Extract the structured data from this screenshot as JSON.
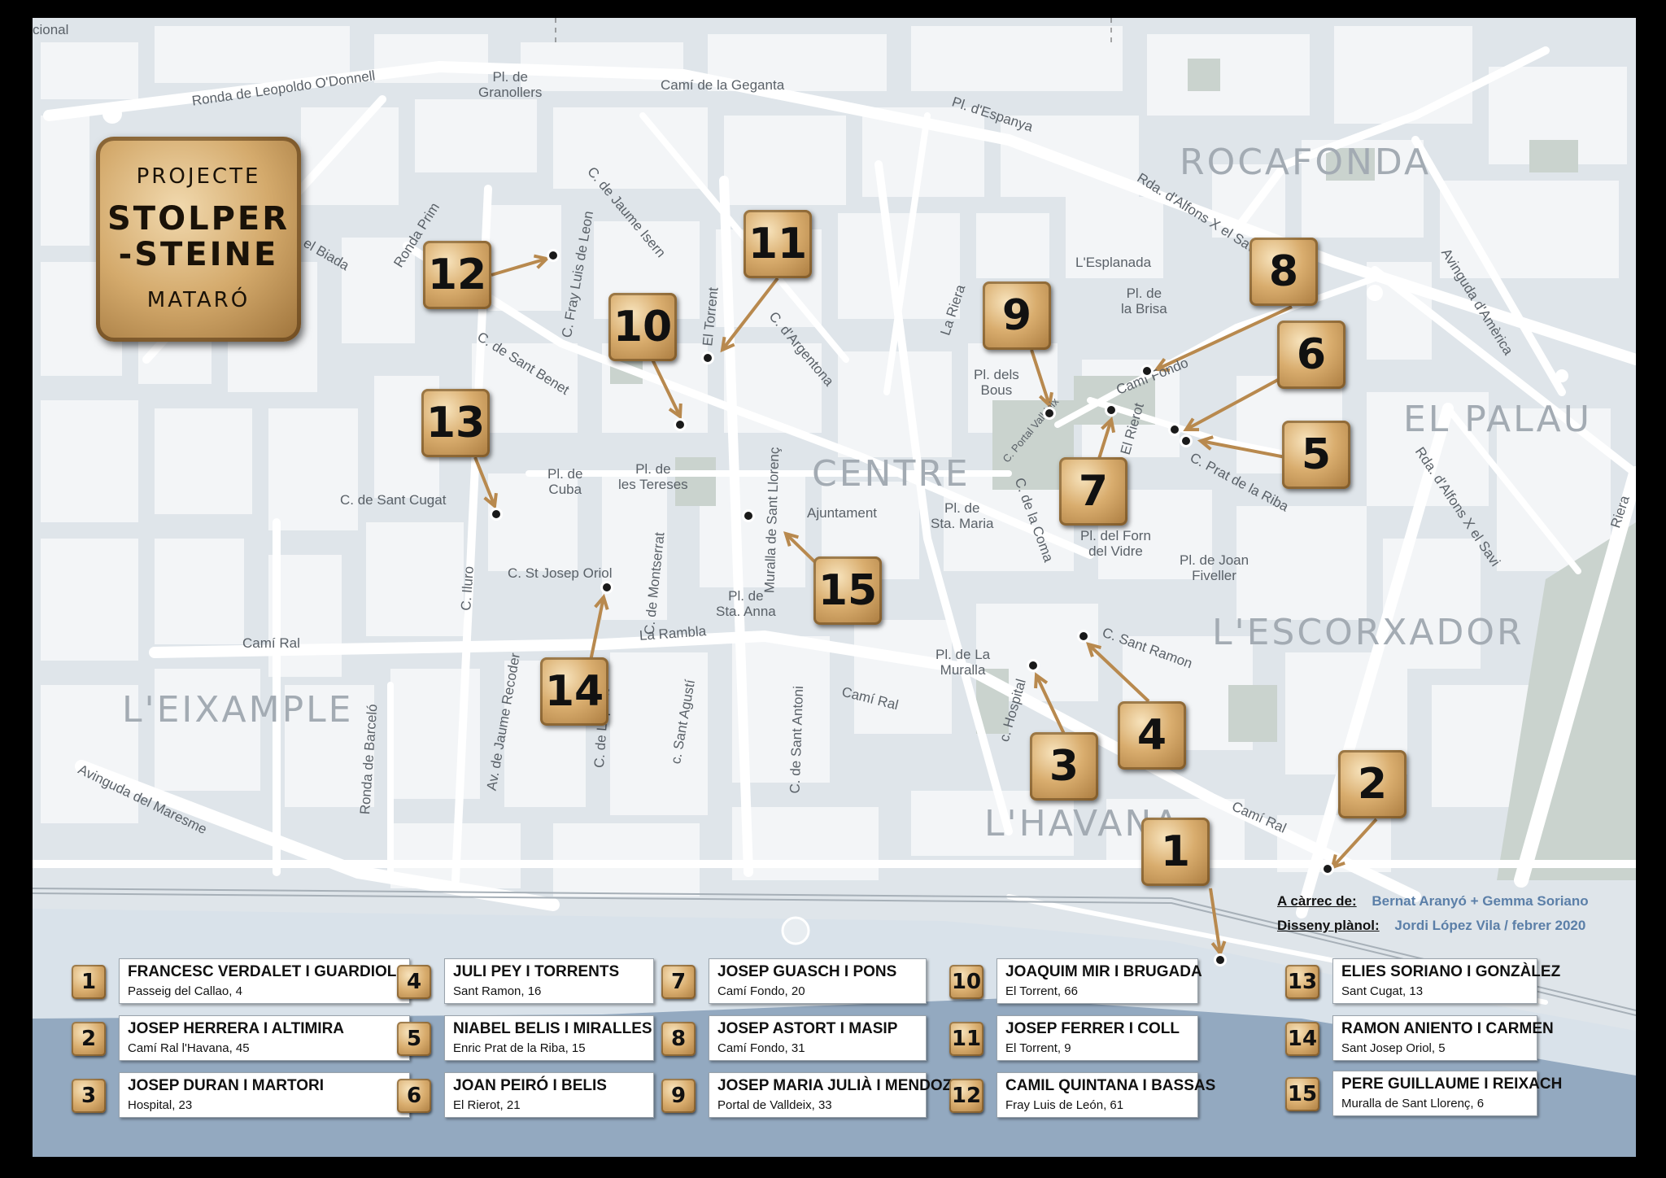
{
  "title": {
    "line1": "PROJECTE",
    "line2": "STOLPER",
    "line3": "-STEINE",
    "line4": "MATARÓ"
  },
  "districts": [
    {
      "id": "rocafonda",
      "text": "ROCAFONDA"
    },
    {
      "id": "el-palau",
      "text": "EL PALAU"
    },
    {
      "id": "centre",
      "text": "CENTRE"
    },
    {
      "id": "escorxador",
      "text": "L'ESCORXADOR"
    },
    {
      "id": "eixample",
      "text": "L'EIXAMPLE"
    },
    {
      "id": "havana",
      "text": "L'HAVANA"
    }
  ],
  "street_labels": [
    "cional",
    "Ronda de Leopoldo O'Donnell",
    "Pl. de\nGranollers",
    "Camí de la Geganta",
    "Pl. d'Espanya",
    "Rda. d'Alfons X el Savi",
    "Avinguda d'Amèrica",
    "el Biada",
    "Ronda Prim",
    "C. de Jaume Isern",
    "C. Fray Luis de Leon",
    "El Torrent",
    "C. d'Argentona",
    "La Riera",
    "L'Esplanada",
    "Pl. de\nla Brisa",
    "C. de Sant Benet",
    "Pl. dels\nBous",
    "C. Portal Valldeix",
    "Camí Fondo",
    "El Rierot",
    "C. Prat de la Riba",
    "Rda. d'Alfons X el Savi",
    "Pl. de\nCuba",
    "Pl. de\nles Tereses",
    "Muralla de Sant Llorenç",
    "C. de Sant Cugat",
    "Ajuntament",
    "Pl. de\nSta. Maria",
    "C. de la Coma",
    "Pl. del Forn\ndel Vidre",
    "Pl. de Joan\nFiveller",
    "C. St Josep Oriol",
    "C. de Montserrat",
    "C. Iluro",
    "Pl. de\nSta. Anna",
    "La Rambla",
    "Camí Ral",
    "C. Sant Ramon",
    "Pl. de La\nMuralla",
    "Av. de Jaume Recoder",
    "Ronda de Barceló",
    "C. de Lepant",
    "c. Sant Agustí",
    "C. de Sant Antoni",
    "Camí Ral",
    "c. Hospital",
    "Camí Ral",
    "Avinguda del Maresme",
    "Riera"
  ],
  "credits": {
    "by_label": "A càrrec de:",
    "by_value": "Bernat Aranyó + Gemma Soriano",
    "design_label": "Disseny plànol:",
    "design_value": "Jordi López Vila  / febrer 2020"
  },
  "stones": [
    {
      "num": "1",
      "name": "FRANCESC VERDALET I GUARDIOLA",
      "address": "Passeig del Callao, 4"
    },
    {
      "num": "2",
      "name": "JOSEP HERRERA I ALTIMIRA",
      "address": "Camí Ral l'Havana, 45"
    },
    {
      "num": "3",
      "name": "JOSEP DURAN I MARTORI",
      "address": "Hospital, 23"
    },
    {
      "num": "4",
      "name": "JULI PEY I TORRENTS",
      "address": "Sant Ramon, 16"
    },
    {
      "num": "5",
      "name": "NIABEL BELIS I MIRALLES",
      "address": "Enric Prat de la Riba, 15"
    },
    {
      "num": "6",
      "name": "JOAN PEIRÓ I BELIS",
      "address": "El Rierot, 21"
    },
    {
      "num": "7",
      "name": "JOSEP GUASCH I PONS",
      "address": "Camí Fondo, 20"
    },
    {
      "num": "8",
      "name": "JOSEP ASTORT I MASIP",
      "address": "Camí Fondo, 31"
    },
    {
      "num": "9",
      "name": "JOSEP MARIA JULIÀ I MENDOZA",
      "address": "Portal de Valldeix, 33"
    },
    {
      "num": "10",
      "name": "JOAQUIM MIR I BRUGADA",
      "address": "El Torrent, 66"
    },
    {
      "num": "11",
      "name": "JOSEP FERRER I COLL",
      "address": "El Torrent, 9"
    },
    {
      "num": "12",
      "name": "CAMIL QUINTANA I BASSAS",
      "address": "Fray Luis de León, 61"
    },
    {
      "num": "13",
      "name": "ELIES SORIANO I GONZÀLEZ",
      "address": "Sant Cugat, 13"
    },
    {
      "num": "14",
      "name": "RAMON ANIENTO I CARMEN",
      "address": "Sant Josep Oriol, 5"
    },
    {
      "num": "15",
      "name": "PERE GUILLAUME I REIXACH",
      "address": "Muralla de Sant Llorenç, 6"
    }
  ],
  "colors": {
    "map_bg": "#dfe5ea",
    "block": "#f2f4f6",
    "street": "#ffffff",
    "park": "#c9d2cc",
    "sea": "#8fa4bd",
    "arrow": "#b8894e",
    "marker_gold": "#d9ad6e"
  }
}
